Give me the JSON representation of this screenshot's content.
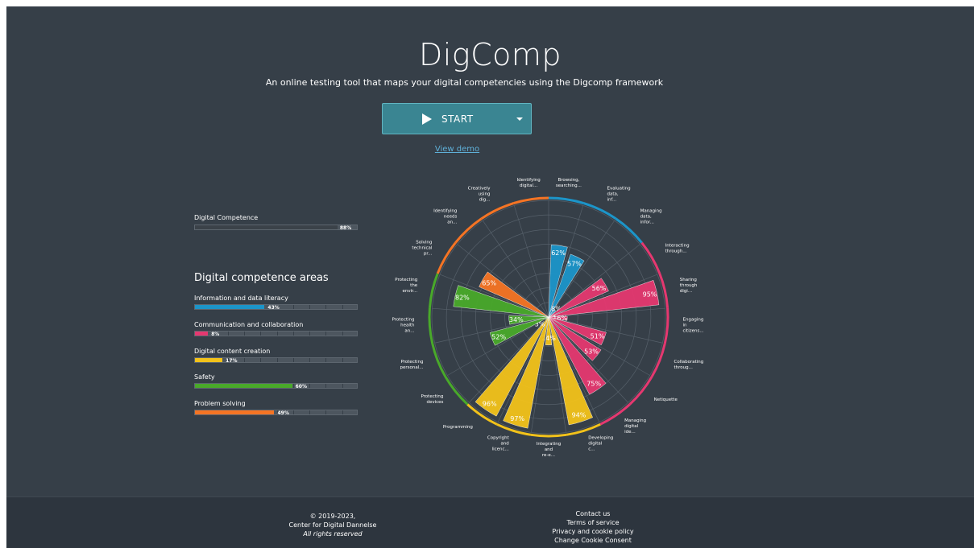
{
  "header": {
    "title": "DigComp",
    "subtitle": "An online testing tool that maps your digital competencies using the Digcomp framework",
    "start_label": "START",
    "demo_link": "View demo"
  },
  "digital_competence": {
    "label": "Digital Competence",
    "value": 88,
    "value_text": "88%"
  },
  "areas": {
    "heading": "Digital competence areas",
    "items": [
      {
        "label": "Information and data literacy",
        "value": 43,
        "value_text": "43%",
        "color": "#1c95c9"
      },
      {
        "label": "Communication and collaboration",
        "value": 8,
        "value_text": "8%",
        "color": "#e53870"
      },
      {
        "label": "Digital content creation",
        "value": 17,
        "value_text": "17%",
        "color": "#f2c21a"
      },
      {
        "label": "Safety",
        "value": 60,
        "value_text": "60%",
        "color": "#49a92a"
      },
      {
        "label": "Problem solving",
        "value": 49,
        "value_text": "49%",
        "color": "#f57424"
      }
    ]
  },
  "chart_data": {
    "type": "polar-bar",
    "radial_range": [
      0,
      100
    ],
    "grid": true,
    "categories": [
      {
        "label": "Browsing, searching...",
        "value": 62,
        "area": "Information and data literacy"
      },
      {
        "label": "Evaluating data, inf...",
        "value": 57,
        "area": "Information and data literacy"
      },
      {
        "label": "Managing data, infor...",
        "value": 8,
        "area": "Information and data literacy"
      },
      {
        "label": "Interacting through...",
        "value": 56,
        "area": "Communication and collaboration"
      },
      {
        "label": "Sharing through digi...",
        "value": 95,
        "area": "Communication and collaboration"
      },
      {
        "label": "Engaging in citizens...",
        "value": 16,
        "area": "Communication and collaboration"
      },
      {
        "label": "Collaborating throug...",
        "value": 51,
        "area": "Communication and collaboration"
      },
      {
        "label": "Netiquette",
        "value": 53,
        "area": "Communication and collaboration"
      },
      {
        "label": "Managing digital ide...",
        "value": 75,
        "area": "Communication and collaboration"
      },
      {
        "label": "Developing digital c...",
        "value": 94,
        "area": "Digital content creation"
      },
      {
        "label": "Integrating and re-e...",
        "value": 24,
        "area": "Digital content creation"
      },
      {
        "label": "Copyright and licenc...",
        "value": 97,
        "area": "Digital content creation"
      },
      {
        "label": "Programming",
        "value": 96,
        "area": "Digital content creation"
      },
      {
        "label": "Protecting devices",
        "value": 3,
        "area": "Safety"
      },
      {
        "label": "Protecting personal...",
        "value": 52,
        "area": "Safety"
      },
      {
        "label": "Protecting health an...",
        "value": 34,
        "area": "Safety"
      },
      {
        "label": "Protecting the envir...",
        "value": 82,
        "area": "Safety"
      },
      {
        "label": "Solving technical pr...",
        "value": 65,
        "area": "Problem solving"
      },
      {
        "label": "Identifying needs an...",
        "value": 0,
        "area": "Problem solving"
      },
      {
        "label": "Creatively using dig...",
        "value": 0,
        "area": "Problem solving"
      },
      {
        "label": "Identifying digital...",
        "value": 0,
        "area": "Problem solving"
      }
    ],
    "area_colors": {
      "Information and data literacy": "#1c95c9",
      "Communication and collaboration": "#e53870",
      "Digital content creation": "#f2c21a",
      "Safety": "#49a92a",
      "Problem solving": "#f57424"
    }
  },
  "footer": {
    "copyright": "© 2019-2023,",
    "org": "Center for Digital Dannelse",
    "rights": "All rights reserved",
    "links": [
      "Contact us",
      "Terms of service",
      "Privacy and cookie policy",
      "Change Cookie Consent"
    ]
  }
}
